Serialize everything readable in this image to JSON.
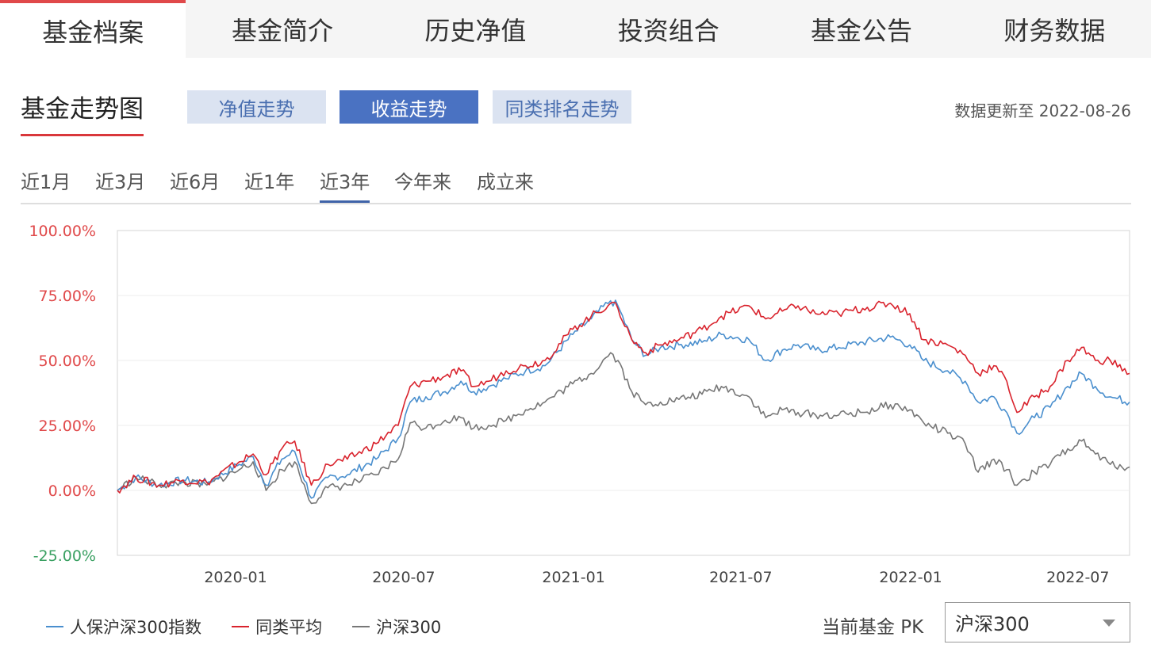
{
  "tabs": [
    {
      "label": "基金档案",
      "active": true
    },
    {
      "label": "基金简介"
    },
    {
      "label": "历史净值"
    },
    {
      "label": "投资组合"
    },
    {
      "label": "基金公告"
    },
    {
      "label": "财务数据"
    }
  ],
  "section_title": "基金走势图",
  "modes": [
    {
      "label": "净值走势"
    },
    {
      "label": "收益走势",
      "active": true
    },
    {
      "label": "同类排名走势"
    }
  ],
  "update_text": "数据更新至 2022-08-26",
  "ranges": [
    {
      "label": "近1月"
    },
    {
      "label": "近3月"
    },
    {
      "label": "近6月"
    },
    {
      "label": "近1年"
    },
    {
      "label": "近3年",
      "active": true
    },
    {
      "label": "今年来"
    },
    {
      "label": "成立来"
    }
  ],
  "pk": {
    "label": "当前基金 PK",
    "selected": "沪深300"
  },
  "colors": {
    "accent_red": "#e0494a",
    "tab_blue": "#4a72c2",
    "positive": "#e0494a",
    "negative": "#3aa062"
  },
  "chart_data": {
    "type": "line",
    "x_range": [
      "2019-08-26",
      "2022-08-26"
    ],
    "x_ticks": [
      "2020-01",
      "2020-07",
      "2021-01",
      "2021-07",
      "2022-01",
      "2022-07"
    ],
    "y_ticks": [
      "100.00%",
      "75.00%",
      "50.00%",
      "25.00%",
      "0.00%",
      "-25.00%"
    ],
    "ylim": [
      -25,
      100
    ],
    "legend": "bottom-left",
    "grid": true,
    "series": [
      {
        "name": "人保沪深300指数",
        "color": "#4a8fce",
        "points": [
          [
            "2019-08-26",
            0
          ],
          [
            "2019-09-15",
            5
          ],
          [
            "2019-10-10",
            2
          ],
          [
            "2019-11-05",
            4
          ],
          [
            "2019-12-01",
            3
          ],
          [
            "2020-01-05",
            10
          ],
          [
            "2020-01-20",
            13
          ],
          [
            "2020-02-03",
            2
          ],
          [
            "2020-02-20",
            12
          ],
          [
            "2020-03-05",
            15
          ],
          [
            "2020-03-23",
            -3
          ],
          [
            "2020-04-10",
            5
          ],
          [
            "2020-05-01",
            6
          ],
          [
            "2020-06-01",
            12
          ],
          [
            "2020-06-25",
            20
          ],
          [
            "2020-07-08",
            34
          ],
          [
            "2020-07-25",
            36
          ],
          [
            "2020-08-15",
            38
          ],
          [
            "2020-09-01",
            42
          ],
          [
            "2020-09-15",
            38
          ],
          [
            "2020-10-01",
            40
          ],
          [
            "2020-10-20",
            43
          ],
          [
            "2020-11-10",
            46
          ],
          [
            "2020-12-01",
            48
          ],
          [
            "2020-12-31",
            60
          ],
          [
            "2021-01-20",
            66
          ],
          [
            "2021-02-10",
            73
          ],
          [
            "2021-02-18",
            71
          ],
          [
            "2021-03-05",
            58
          ],
          [
            "2021-03-20",
            52
          ],
          [
            "2021-04-05",
            55
          ],
          [
            "2021-04-25",
            56
          ],
          [
            "2021-05-20",
            57
          ],
          [
            "2021-06-10",
            60
          ],
          [
            "2021-07-10",
            58
          ],
          [
            "2021-07-28",
            50
          ],
          [
            "2021-08-15",
            54
          ],
          [
            "2021-09-01",
            56
          ],
          [
            "2021-09-20",
            54
          ],
          [
            "2021-10-15",
            55
          ],
          [
            "2021-11-10",
            57
          ],
          [
            "2021-12-10",
            59
          ],
          [
            "2021-12-31",
            56
          ],
          [
            "2022-01-15",
            50
          ],
          [
            "2022-02-10",
            46
          ],
          [
            "2022-03-01",
            42
          ],
          [
            "2022-03-15",
            34
          ],
          [
            "2022-04-01",
            36
          ],
          [
            "2022-04-15",
            30
          ],
          [
            "2022-04-26",
            22
          ],
          [
            "2022-05-15",
            28
          ],
          [
            "2022-06-01",
            32
          ],
          [
            "2022-06-20",
            40
          ],
          [
            "2022-07-05",
            45
          ],
          [
            "2022-07-20",
            40
          ],
          [
            "2022-08-05",
            36
          ],
          [
            "2022-08-26",
            34
          ]
        ]
      },
      {
        "name": "同类平均",
        "color": "#d9232d",
        "points": [
          [
            "2019-08-26",
            0
          ],
          [
            "2019-09-15",
            5
          ],
          [
            "2019-10-10",
            2
          ],
          [
            "2019-11-05",
            4
          ],
          [
            "2019-12-01",
            3
          ],
          [
            "2020-01-05",
            11
          ],
          [
            "2020-01-20",
            14
          ],
          [
            "2020-02-03",
            6
          ],
          [
            "2020-02-20",
            16
          ],
          [
            "2020-03-05",
            19
          ],
          [
            "2020-03-23",
            2
          ],
          [
            "2020-04-10",
            10
          ],
          [
            "2020-05-01",
            12
          ],
          [
            "2020-06-01",
            18
          ],
          [
            "2020-06-25",
            25
          ],
          [
            "2020-07-08",
            40
          ],
          [
            "2020-07-25",
            42
          ],
          [
            "2020-08-15",
            44
          ],
          [
            "2020-09-01",
            46
          ],
          [
            "2020-09-15",
            40
          ],
          [
            "2020-10-01",
            42
          ],
          [
            "2020-10-20",
            46
          ],
          [
            "2020-11-10",
            48
          ],
          [
            "2020-12-01",
            50
          ],
          [
            "2020-12-31",
            62
          ],
          [
            "2021-01-20",
            67
          ],
          [
            "2021-02-10",
            72
          ],
          [
            "2021-02-18",
            70
          ],
          [
            "2021-03-05",
            58
          ],
          [
            "2021-03-20",
            53
          ],
          [
            "2021-04-05",
            56
          ],
          [
            "2021-04-25",
            58
          ],
          [
            "2021-05-20",
            62
          ],
          [
            "2021-06-10",
            67
          ],
          [
            "2021-07-10",
            71
          ],
          [
            "2021-07-28",
            66
          ],
          [
            "2021-08-15",
            69
          ],
          [
            "2021-09-01",
            71
          ],
          [
            "2021-09-20",
            68
          ],
          [
            "2021-10-15",
            68
          ],
          [
            "2021-11-10",
            70
          ],
          [
            "2021-12-10",
            72
          ],
          [
            "2021-12-31",
            68
          ],
          [
            "2022-01-15",
            58
          ],
          [
            "2022-02-10",
            56
          ],
          [
            "2022-03-01",
            52
          ],
          [
            "2022-03-15",
            45
          ],
          [
            "2022-04-01",
            48
          ],
          [
            "2022-04-15",
            42
          ],
          [
            "2022-04-26",
            30
          ],
          [
            "2022-05-15",
            36
          ],
          [
            "2022-06-01",
            40
          ],
          [
            "2022-06-20",
            50
          ],
          [
            "2022-07-05",
            55
          ],
          [
            "2022-07-20",
            50
          ],
          [
            "2022-08-05",
            50
          ],
          [
            "2022-08-26",
            45
          ]
        ]
      },
      {
        "name": "沪深300",
        "color": "#777777",
        "points": [
          [
            "2019-08-26",
            0
          ],
          [
            "2019-09-15",
            5
          ],
          [
            "2019-10-10",
            2
          ],
          [
            "2019-11-05",
            3
          ],
          [
            "2019-12-01",
            2
          ],
          [
            "2020-01-05",
            8
          ],
          [
            "2020-01-20",
            11
          ],
          [
            "2020-02-03",
            0
          ],
          [
            "2020-02-20",
            8
          ],
          [
            "2020-03-05",
            11
          ],
          [
            "2020-03-23",
            -5
          ],
          [
            "2020-04-10",
            1
          ],
          [
            "2020-05-01",
            2
          ],
          [
            "2020-06-01",
            6
          ],
          [
            "2020-06-25",
            12
          ],
          [
            "2020-07-08",
            26
          ],
          [
            "2020-07-25",
            24
          ],
          [
            "2020-08-15",
            27
          ],
          [
            "2020-09-01",
            28
          ],
          [
            "2020-09-15",
            24
          ],
          [
            "2020-10-01",
            25
          ],
          [
            "2020-10-20",
            27
          ],
          [
            "2020-11-10",
            31
          ],
          [
            "2020-12-01",
            34
          ],
          [
            "2020-12-31",
            41
          ],
          [
            "2021-01-20",
            45
          ],
          [
            "2021-02-10",
            53
          ],
          [
            "2021-02-18",
            50
          ],
          [
            "2021-03-05",
            38
          ],
          [
            "2021-03-20",
            33
          ],
          [
            "2021-04-05",
            34
          ],
          [
            "2021-04-25",
            35
          ],
          [
            "2021-05-20",
            37
          ],
          [
            "2021-06-10",
            40
          ],
          [
            "2021-07-10",
            36
          ],
          [
            "2021-07-28",
            28
          ],
          [
            "2021-08-15",
            31
          ],
          [
            "2021-09-01",
            30
          ],
          [
            "2021-09-20",
            29
          ],
          [
            "2021-10-15",
            29
          ],
          [
            "2021-11-10",
            30
          ],
          [
            "2021-12-10",
            33
          ],
          [
            "2021-12-31",
            31
          ],
          [
            "2022-01-15",
            26
          ],
          [
            "2022-02-10",
            22
          ],
          [
            "2022-03-01",
            18
          ],
          [
            "2022-03-15",
            7
          ],
          [
            "2022-04-01",
            12
          ],
          [
            "2022-04-15",
            8
          ],
          [
            "2022-04-26",
            2
          ],
          [
            "2022-05-15",
            7
          ],
          [
            "2022-06-01",
            10
          ],
          [
            "2022-06-20",
            16
          ],
          [
            "2022-07-05",
            19
          ],
          [
            "2022-07-20",
            14
          ],
          [
            "2022-08-05",
            10
          ],
          [
            "2022-08-26",
            9
          ]
        ]
      }
    ]
  }
}
